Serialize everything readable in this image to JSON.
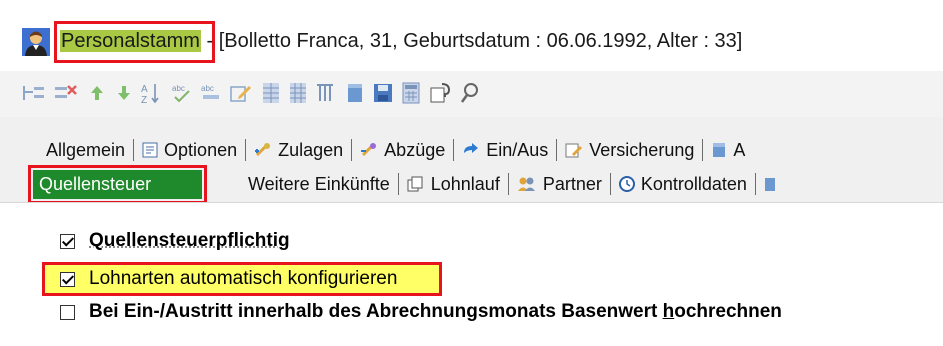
{
  "window": {
    "title_main": "Personalstamm",
    "title_rest": " - [Bolletto Franca, 31, Geburtsdatum : 06.06.1992, Alter : 33]"
  },
  "toolbar": {
    "buttons": [
      "insert-row-icon",
      "delete-row-icon",
      "move-up-icon",
      "move-down-icon",
      "sort-az-icon",
      "spellcheck-icon",
      "abc-icon",
      "edit-icon",
      "grid-a-icon",
      "grid-b-icon",
      "filter-icon",
      "book-icon",
      "save-icon",
      "calculator-icon",
      "properties-icon",
      "search-icon"
    ]
  },
  "tabs": {
    "row1": [
      {
        "label": "Allgemein",
        "icon": ""
      },
      {
        "label": "Optionen",
        "icon": "options-icon"
      },
      {
        "label": "Zulagen",
        "icon": "zulagen-icon"
      },
      {
        "label": "Abzüge",
        "icon": "abzuege-icon"
      },
      {
        "label": "Ein/Aus",
        "icon": "ein-aus-icon"
      },
      {
        "label": "Versicherung",
        "icon": "versicherung-icon"
      },
      {
        "label": "A",
        "icon": "book-icon"
      }
    ],
    "row2": [
      {
        "label": "Weitere Einkünfte",
        "icon": ""
      },
      {
        "label": "Lohnlauf",
        "icon": "lohnlauf-icon"
      },
      {
        "label": "Partner",
        "icon": "partner-icon"
      },
      {
        "label": "Kontrolldaten",
        "icon": "kontrolldaten-icon"
      }
    ],
    "active": "Quellensteuer"
  },
  "options": {
    "quellensteuerpflichtig": {
      "label": "Quellensteuerpflichtig",
      "checked": true
    },
    "lohnarten": {
      "label": "Lohnarten automatisch konfigurieren",
      "checked": true
    },
    "hochrechnen": {
      "label_pre": "Bei Ein-/Austritt innerhalb des Abrechnungsmonats Basenwert ",
      "label_accel": "h",
      "label_post": "ochrechnen",
      "checked": false
    }
  },
  "colors": {
    "highlight_border": "#e8141d",
    "active_tab": "#1e8a2c",
    "title_highlight": "#a9c844",
    "checkbox_highlight": "#ffff66"
  }
}
